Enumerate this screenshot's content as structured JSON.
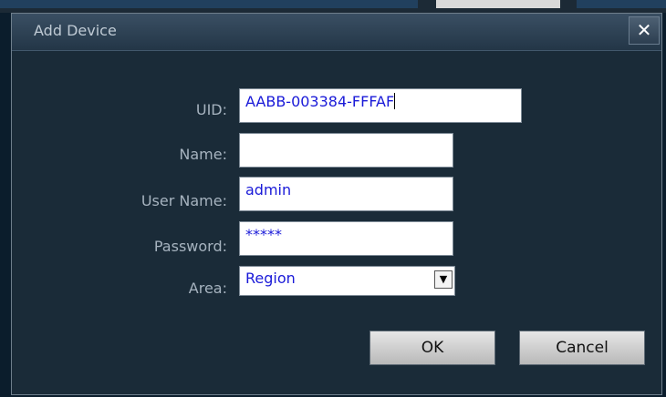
{
  "dialog": {
    "title": "Add Device",
    "close_glyph": "✕"
  },
  "form": {
    "uid": {
      "label": "UID:",
      "value": "AABB-003384-FFFAF"
    },
    "name": {
      "label": "Name:",
      "value": ""
    },
    "user_name": {
      "label": "User Name:",
      "value": "admin"
    },
    "password": {
      "label": "Password:",
      "value": "*****"
    },
    "area": {
      "label": "Area:",
      "value": "Region",
      "arrow_glyph": "▼"
    }
  },
  "buttons": {
    "ok": "OK",
    "cancel": "Cancel"
  },
  "icons": {
    "close": "close-icon",
    "dropdown": "chevron-down-icon"
  },
  "colors": {
    "dialog_bg": "#1a2b38",
    "field_text": "#1a1ad8",
    "label_text": "#a6b3bf"
  }
}
